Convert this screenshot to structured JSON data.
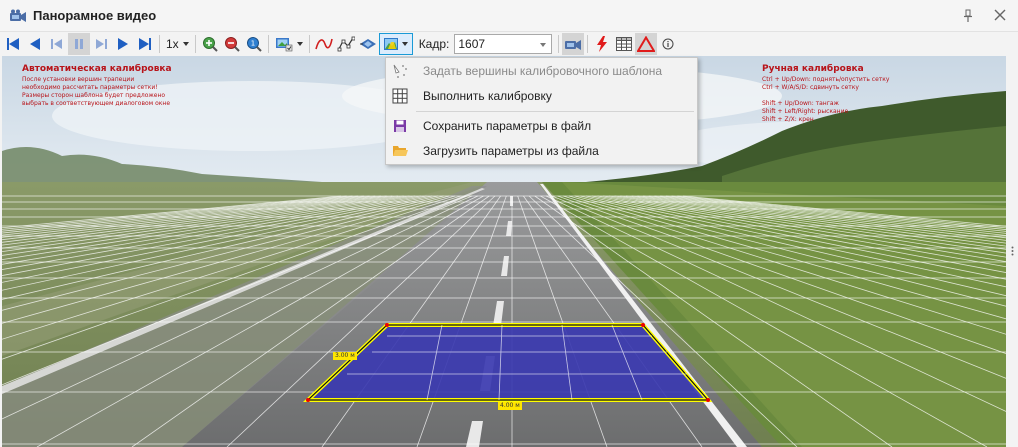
{
  "window": {
    "title": "Панорамное видео",
    "icons": [
      "video-camera-icon",
      "pin-icon",
      "close-icon"
    ]
  },
  "toolbar": {
    "speed": "1x",
    "frame_label": "Кадр:",
    "frame_value": "1607",
    "buttons": [
      "skip-to-start",
      "step-back",
      "prev-frame",
      "pause",
      "next-frame",
      "play",
      "skip-to-end",
      "zoom-in",
      "zoom-out",
      "zoom-fit",
      "export-image",
      "curve",
      "polyline",
      "layer",
      "calibration",
      "camera",
      "lightning",
      "grid",
      "triangle",
      "info"
    ]
  },
  "menu": {
    "items": [
      {
        "label": "Задать вершины калибровочного шаблона",
        "icon": "vertices-icon",
        "enabled": false
      },
      {
        "label": "Выполнить калибровку",
        "icon": "grid-icon",
        "enabled": true
      },
      {
        "label": "Сохранить параметры в файл",
        "icon": "save-icon",
        "enabled": true
      },
      {
        "label": "Загрузить параметры из файла",
        "icon": "folder-open-icon",
        "enabled": true
      }
    ]
  },
  "overlay": {
    "auto_title": "Автоматическая калибровка",
    "auto_lines": [
      "После установки вершин трапеции",
      "необходимо рассчитать параметры сетки!",
      "Размеры сторон шаблона будет предложено",
      "выбрать в соответствующем диалоговом окне"
    ],
    "manual_title": "Ручная калибровка",
    "manual_lines": [
      "Ctrl + Up/Down: поднять/опустить сетку",
      "Ctrl + W/A/S/D: сдвинуть сетку",
      "",
      "Shift + Up/Down: тангаж",
      "Shift + Left/Right: рыскание",
      "Shift + Z/X: крен"
    ],
    "side_label": "3.00 м",
    "bottom_label": "4.00 м"
  },
  "colors": {
    "template_fill": "#3b3ab0",
    "template_edge": "#ffff00",
    "overlay_text": "#b8141a",
    "accent": "#1a9ad6"
  }
}
